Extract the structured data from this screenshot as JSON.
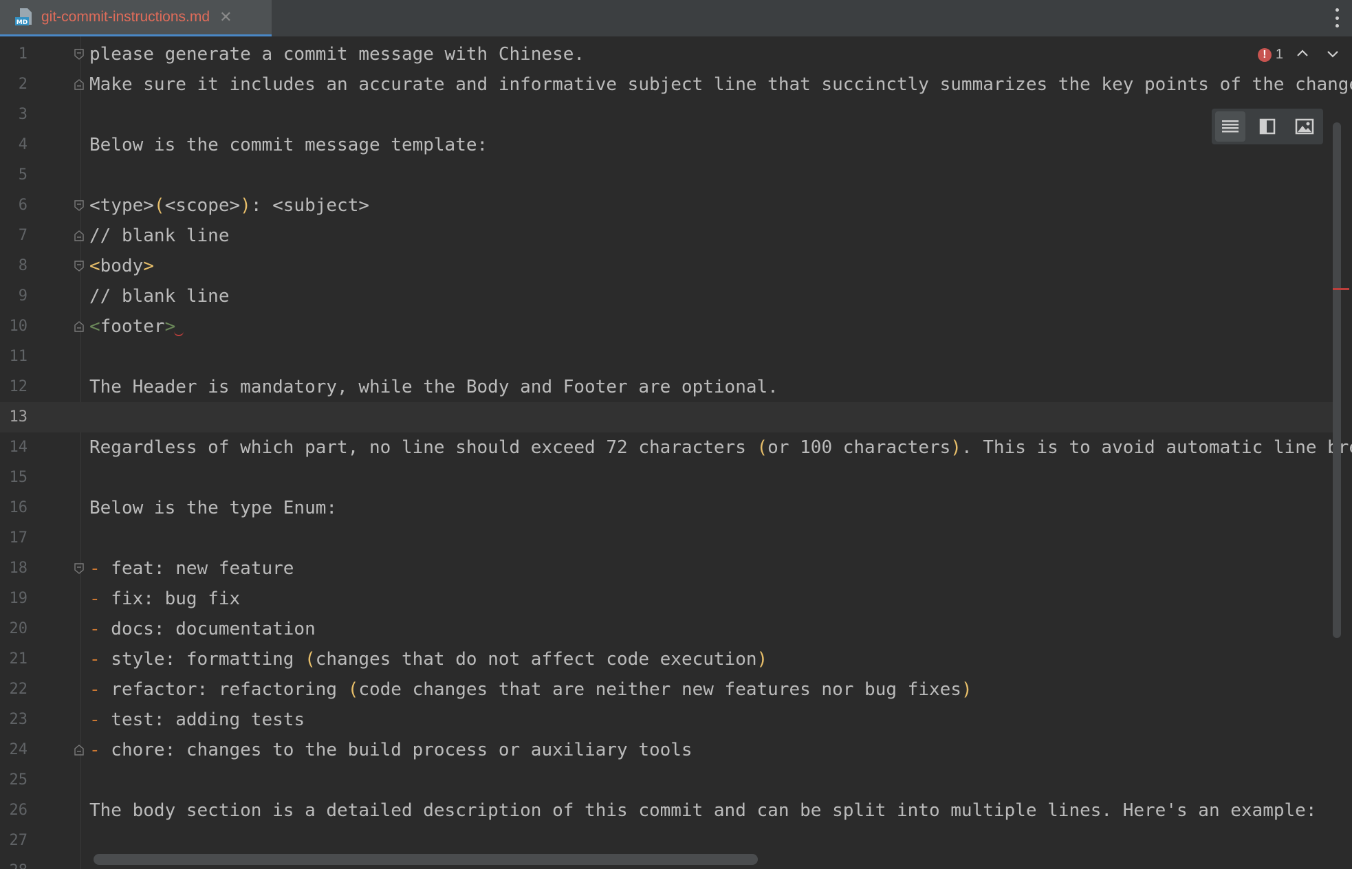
{
  "tab": {
    "title": "git-commit-instructions.md",
    "icon": "markdown-file-icon",
    "close_glyph": "✕",
    "icon_label": "MD"
  },
  "inspection": {
    "error_count": "1",
    "error_glyph": "!"
  },
  "editor_modes": [
    "editor-only",
    "editor-and-preview",
    "preview-only"
  ],
  "lines": [
    {
      "n": "1",
      "segs": [
        {
          "t": "please generate a commit message with Chinese.",
          "c": ""
        }
      ]
    },
    {
      "n": "2",
      "segs": [
        {
          "t": "Make sure it includes an accurate and informative subject line that succinctly summarizes the key points of the change",
          "c": ""
        }
      ]
    },
    {
      "n": "3",
      "segs": []
    },
    {
      "n": "4",
      "segs": [
        {
          "t": "Below is the commit message template:",
          "c": ""
        }
      ]
    },
    {
      "n": "5",
      "segs": []
    },
    {
      "n": "6",
      "segs": [
        {
          "t": "<type>",
          "c": ""
        },
        {
          "t": "(",
          "c": "y"
        },
        {
          "t": "<scope>",
          "c": ""
        },
        {
          "t": ")",
          "c": "y"
        },
        {
          "t": ": <subject>",
          "c": ""
        }
      ]
    },
    {
      "n": "7",
      "segs": [
        {
          "t": "// blank line",
          "c": ""
        }
      ]
    },
    {
      "n": "8",
      "segs": [
        {
          "t": "<",
          "c": "y"
        },
        {
          "t": "body",
          "c": ""
        },
        {
          "t": ">",
          "c": "y"
        }
      ]
    },
    {
      "n": "9",
      "segs": [
        {
          "t": "// blank line",
          "c": ""
        }
      ]
    },
    {
      "n": "10",
      "segs": [
        {
          "t": "<",
          "c": "g"
        },
        {
          "t": "footer",
          "c": ""
        },
        {
          "t": ">",
          "c": "g"
        }
      ],
      "squiggle": true
    },
    {
      "n": "11",
      "segs": []
    },
    {
      "n": "12",
      "segs": [
        {
          "t": "The Header is mandatory, while the Body and Footer are optional.",
          "c": ""
        }
      ]
    },
    {
      "n": "13",
      "segs": [],
      "current": true
    },
    {
      "n": "14",
      "segs": [
        {
          "t": "Regardless of which part, no line should exceed 72 characters ",
          "c": ""
        },
        {
          "t": "(",
          "c": "y"
        },
        {
          "t": "or 100 characters",
          "c": ""
        },
        {
          "t": ")",
          "c": "y"
        },
        {
          "t": ". This is to avoid automatic line breaks",
          "c": ""
        }
      ]
    },
    {
      "n": "15",
      "segs": []
    },
    {
      "n": "16",
      "segs": [
        {
          "t": "Below is the type Enum:",
          "c": ""
        }
      ]
    },
    {
      "n": "17",
      "segs": []
    },
    {
      "n": "18",
      "segs": [
        {
          "t": "-",
          "c": "o"
        },
        {
          "t": " feat: new feature",
          "c": ""
        }
      ]
    },
    {
      "n": "19",
      "segs": [
        {
          "t": "-",
          "c": "o"
        },
        {
          "t": " fix: bug fix",
          "c": ""
        }
      ]
    },
    {
      "n": "20",
      "segs": [
        {
          "t": "-",
          "c": "o"
        },
        {
          "t": " docs: documentation",
          "c": ""
        }
      ]
    },
    {
      "n": "21",
      "segs": [
        {
          "t": "-",
          "c": "o"
        },
        {
          "t": " style: formatting ",
          "c": ""
        },
        {
          "t": "(",
          "c": "y"
        },
        {
          "t": "changes that do not affect code execution",
          "c": ""
        },
        {
          "t": ")",
          "c": "y"
        }
      ]
    },
    {
      "n": "22",
      "segs": [
        {
          "t": "-",
          "c": "o"
        },
        {
          "t": " refactor: refactoring ",
          "c": ""
        },
        {
          "t": "(",
          "c": "y"
        },
        {
          "t": "code changes that are neither new features nor bug fixes",
          "c": ""
        },
        {
          "t": ")",
          "c": "y"
        }
      ]
    },
    {
      "n": "23",
      "segs": [
        {
          "t": "-",
          "c": "o"
        },
        {
          "t": " test: adding tests",
          "c": ""
        }
      ]
    },
    {
      "n": "24",
      "segs": [
        {
          "t": "-",
          "c": "o"
        },
        {
          "t": " chore: changes to the build process or auxiliary tools",
          "c": ""
        }
      ]
    },
    {
      "n": "25",
      "segs": []
    },
    {
      "n": "26",
      "segs": [
        {
          "t": "The body section is a detailed description of this commit and can be split into multiple lines. Here's an example:",
          "c": ""
        }
      ]
    },
    {
      "n": "27",
      "segs": []
    },
    {
      "n": "28",
      "segs": []
    }
  ],
  "fold_markers": {
    "1": "open",
    "2": "close",
    "6": "open",
    "7": "close",
    "8": "open",
    "10": "close",
    "18": "open",
    "24": "close"
  },
  "colors": {
    "background": "#2b2b2b",
    "text": "#bbbbbb",
    "bracket": "#e8bf6a",
    "tag_green": "#6a8759",
    "list_marker": "#cc7832",
    "error": "#c75450",
    "tab_title": "#e06c5a"
  }
}
